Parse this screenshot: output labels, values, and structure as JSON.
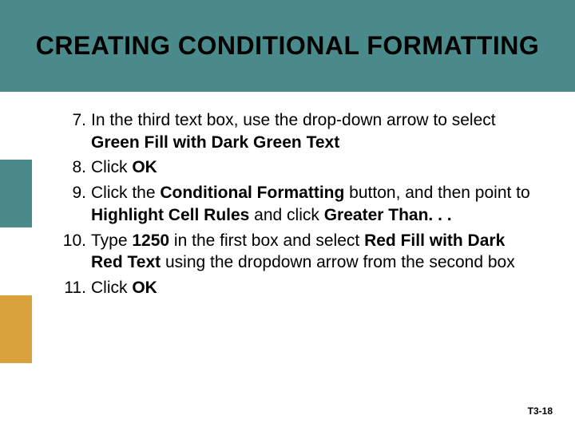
{
  "title": "CREATING CONDITIONAL FORMATTING",
  "steps": {
    "s7_a": "In the third text box, use the drop-down arrow to select ",
    "s7_b": "Green Fill with Dark Green Text",
    "s8_a": "Click ",
    "s8_b": "OK",
    "s9_a": "Click the ",
    "s9_b": "Conditional Formatting",
    "s9_c": " button, and then point to ",
    "s9_d": "Highlight Cell Rules",
    "s9_e": " and click ",
    "s9_f": "Greater Than. . .",
    "s10_a": "Type ",
    "s10_b": "1250",
    "s10_c": " in the first box and select ",
    "s10_d": "Red Fill with Dark Red Text",
    "s10_e": " using the dropdown arrow from the second box",
    "s11_a": "Click ",
    "s11_b": "OK"
  },
  "footer": "T3-18"
}
